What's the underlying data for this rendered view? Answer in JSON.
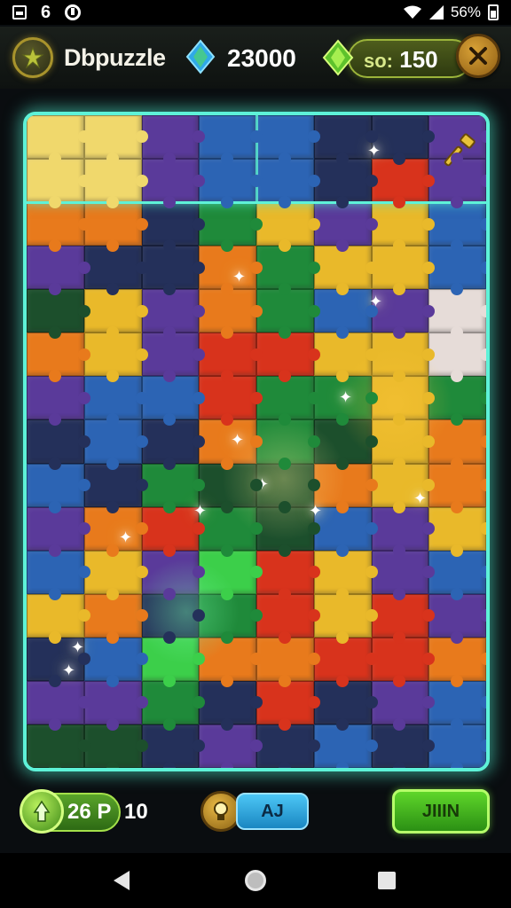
{
  "status_bar": {
    "time": "6",
    "battery_text": "56%"
  },
  "header": {
    "app_title": "Dbpuzzle",
    "score": "23000",
    "moves_label": "so:",
    "moves_value": "150"
  },
  "footer": {
    "hint_value": "26 P",
    "hint_count": "10",
    "auto_label": "AJ",
    "main_label": "JIIIN"
  },
  "colors": {
    "accent_cyan": "#5ef2d8",
    "gold": "#d9a236",
    "green_button": "#5fd62a",
    "blue_button": "#4cc7f5"
  },
  "icons": [
    "brand-leaf-icon",
    "gem-icon",
    "close-icon",
    "hammer-icon",
    "hint-icon",
    "bulb-icon",
    "back-icon",
    "home-icon",
    "recent-icon"
  ],
  "board": {
    "columns": 8,
    "rows": 15,
    "palette": {
      "P": "#5a3a9a",
      "B": "#2c64b4",
      "G": "#1f8a3a",
      "D": "#1c4f2c",
      "Y": "#e9b92a",
      "O": "#e87a1c",
      "R": "#d8331c",
      "N": "#24305a",
      "T": "#2d6f86",
      "W": "#e6dcd8",
      "L": "#3ccf4a",
      "C": "#f0d86c"
    },
    "tiles": [
      "CCPBBNNP",
      "CCPBBNRP",
      "OONGYPYB",
      "PNNOGYYB",
      "DYPOGBPW",
      "OYPRRYYW",
      "PBBRGGYG",
      "NBNOGDYO",
      "BNGDDOYO",
      "PORGDBPY",
      "BYPLRYPB",
      "YONGRYRP",
      "NBLOORRO",
      "PPGNRNPB",
      "DDNPNBNB"
    ]
  }
}
